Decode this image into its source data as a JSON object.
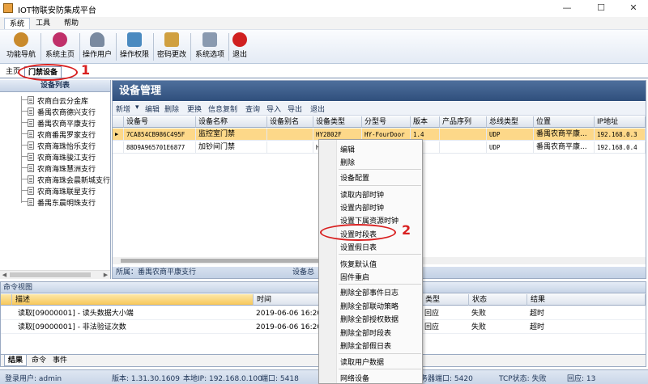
{
  "window": {
    "title": "IOT物联安防集成平台",
    "minimize": "—",
    "maximize": "☐",
    "close": "✕"
  },
  "menubar": [
    "系统",
    "工具",
    "帮助"
  ],
  "toolbar": [
    {
      "label": "功能导航",
      "icon": "compass-icon",
      "color": "#c98a2c"
    },
    {
      "label": "系统主页",
      "icon": "flower-icon",
      "color": "#c0306a"
    },
    {
      "label": "操作用户",
      "icon": "user-icon",
      "color": "#7a8aa0"
    },
    {
      "label": "操作权限",
      "icon": "permission-icon",
      "color": "#4a8ac0"
    },
    {
      "label": "密码更改",
      "icon": "password-icon",
      "color": "#d0a040"
    },
    {
      "label": "系统选项",
      "icon": "tools-icon",
      "color": "#8a9ab0"
    },
    {
      "label": "退出",
      "icon": "power-icon",
      "color": "#d02020"
    }
  ],
  "tabs": {
    "home": "主页",
    "door": "门禁设备"
  },
  "annotations": {
    "one": "1",
    "two": "2",
    "color": "#d81e1e"
  },
  "left_panel": {
    "title": "设备列表",
    "items": [
      "农商白云分金库",
      "番禺农商德兴支行",
      "番禺农商平康支行",
      "农商番禺罗家支行",
      "农商海珠怡乐支行",
      "农商海珠骏江支行",
      "农商海珠慧洲支行",
      "农商海珠会晨新城支行",
      "农商海珠联星支行",
      "番禺东晨明珠支行"
    ]
  },
  "right_panel": {
    "title": "设备管理",
    "toolbar": [
      "新增",
      "▾",
      "编辑",
      "删除",
      "更换",
      "信息复制",
      "查询",
      "导入",
      "导出",
      "退出"
    ],
    "columns": [
      "设备号",
      "设备名称",
      "设备别名",
      "设备类型",
      "分型号",
      "版本",
      "产品序列",
      "总线类型",
      "位置",
      "IP地址"
    ],
    "rows": [
      [
        "7CA854CB986C495F",
        "监控室门禁",
        "",
        "HY2802F",
        "HY-FourDoor",
        "1.4",
        "",
        "UDP",
        "番禺农商平康...",
        "192.168.0.3"
      ],
      [
        "88D9A965701E6877",
        "加钞间门禁",
        "",
        "H",
        "",
        "",
        "",
        "UDP",
        "番禺农商平康...",
        "192.168.0.4"
      ]
    ],
    "status": "所属：番禺农商平康支行",
    "status_right": "设备总"
  },
  "command_view": {
    "title": "命令视图",
    "columns": [
      "描述",
      "时间",
      "",
      "类型",
      "状态",
      "结果"
    ],
    "rows": [
      [
        "读取[09000001] - 读头数据大小端",
        "2019-06-06 16:20:5",
        "",
        "回应",
        "失败",
        "超时"
      ],
      [
        "读取[09000001] - 非法验证次数",
        "2019-06-06 16:20:5",
        "",
        "回应",
        "失败",
        "超时"
      ]
    ],
    "tabs": [
      "结果",
      "命令",
      "事件"
    ]
  },
  "statusbar": {
    "user": "登录用户: admin",
    "version": "版本: 1.31.30.1609",
    "local_ip": "本地IP: 192.168.0.100",
    "port": "端口: 5418",
    "server": "服务器端口: 5420",
    "tcp": "TCP状态: 失败",
    "reply": "回应: 13"
  },
  "context_menu": {
    "items": [
      "编辑",
      "删除",
      "设备配置",
      "读取内部时钟",
      "设置内部时钟",
      "设置下属资源时钟",
      "设置时段表",
      "设置假日表",
      "恢复默认值",
      "固件重启",
      "删除全部事件日志",
      "删除全部联动策略",
      "删除全部授权数据",
      "删除全部时段表",
      "删除全部假日表",
      "读取用户数据",
      "网络设备"
    ]
  },
  "colors": {
    "selected_row": "#fdd889",
    "header_blue": "#2f4f7c"
  }
}
